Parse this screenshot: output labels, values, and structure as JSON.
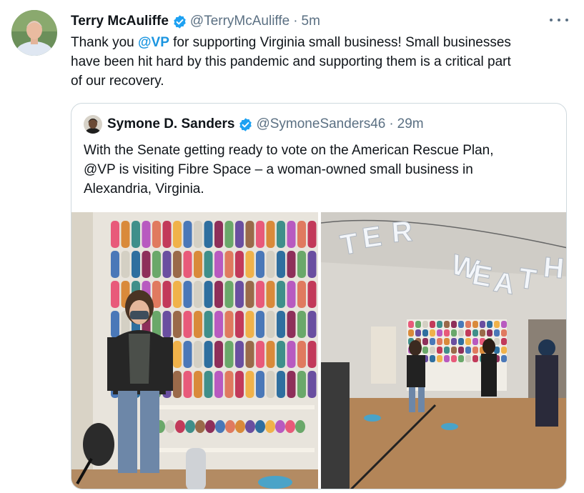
{
  "tweet": {
    "author_name": "Terry McAuliffe",
    "author_handle": "@TerryMcAuliffe",
    "separator": "·",
    "time": "5m",
    "text_line1_before": "Thank you ",
    "text_mention": "@VP",
    "text_line1_after": " for supporting Virginia small business! Small businesses",
    "text_line2": "have been hit hard by this pandemic and supporting them is a critical part",
    "text_line3": "of our recovery.",
    "more_icon": "ellipsis-icon",
    "verified_icon": "verified-badge-icon"
  },
  "quoted_tweet": {
    "author_name": "Symone D. Sanders",
    "author_handle": "@SymoneSanders46",
    "separator": "·",
    "time": "29m",
    "text_line1": "With the Senate getting ready to vote on the American Rescue Plan,",
    "text_line2": "@VP is visiting Fibre Space – a woman-owned small business in",
    "text_line3": "Alexandria, Virginia."
  },
  "media": {
    "photo_left_desc": "yarn-wall-photo",
    "photo_right_desc": "shop-interior-photo",
    "banner_letters": [
      "T",
      "E",
      "R",
      "W",
      "E",
      "A",
      "T",
      "H"
    ]
  },
  "colors": {
    "text": "#0f1419",
    "secondary": "#5b7083",
    "link": "#1b95e0",
    "verified": "#1da1f2",
    "border": "#cfd9de"
  }
}
